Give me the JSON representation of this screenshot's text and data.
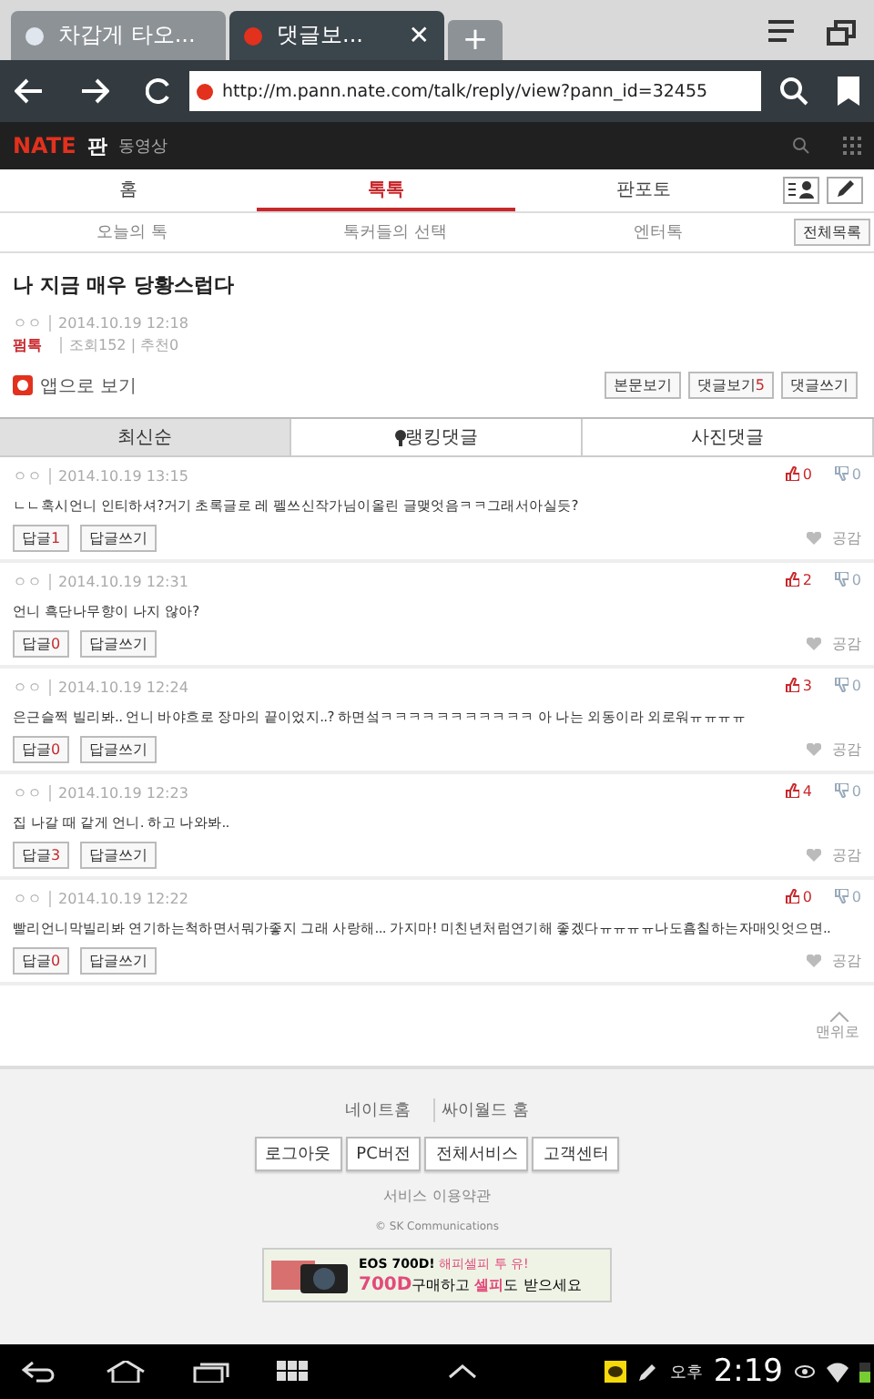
{
  "browser": {
    "tabs": [
      {
        "title": "차갑게 타오...",
        "selected": false
      },
      {
        "title": "댓글보...",
        "selected": true
      }
    ],
    "new_tab": "+",
    "close": "✕",
    "url": "http://m.pann.nate.com/talk/reply/view?pann_id=32455"
  },
  "site": {
    "logo": "NATE",
    "logo_sub": "판",
    "section": "동영상"
  },
  "nav": [
    {
      "label": "홈",
      "selected": false
    },
    {
      "label": "톡톡",
      "selected": true
    },
    {
      "label": "판포토",
      "selected": false
    }
  ],
  "subnav": [
    {
      "label": "오늘의 톡"
    },
    {
      "label": "톡커들의 선택"
    },
    {
      "label": "엔터톡"
    }
  ],
  "all_list": "전체목록",
  "post": {
    "title": "나 지금 매우 당황스럽다",
    "author": "ㅇㅇ",
    "date": "2014.10.19 12:18",
    "category": "펌톡",
    "stats": "조회152 | 추천0"
  },
  "app_link": "앱으로 보기",
  "post_buttons": [
    {
      "label": "본문보기"
    },
    {
      "label": "댓글보기",
      "count": "5"
    },
    {
      "label": "댓글쓰기"
    }
  ],
  "sort_tabs": [
    {
      "label": "최신순",
      "selected": true
    },
    {
      "label": "랭킹댓글",
      "selected": false
    },
    {
      "label": "사진댓글",
      "selected": false
    }
  ],
  "comments": [
    {
      "author": "ㅇㅇ",
      "date": "2014.10.19 13:15",
      "up": "0",
      "down": "0",
      "text": "ㄴㄴ혹시언니 인티하셔?거기 초록글로 레 펠쓰신작가님이올린 글맺엇음ㅋㅋ그래서아실듯?",
      "reply_label": "답글",
      "replies": "1",
      "write_reply": "답글쓰기",
      "like": "공감"
    },
    {
      "author": "ㅇㅇ",
      "date": "2014.10.19 12:31",
      "up": "2",
      "down": "0",
      "text": "언니 흑단나무향이 나지 않아?",
      "reply_label": "답글",
      "replies": "0",
      "write_reply": "답글쓰기",
      "like": "공감"
    },
    {
      "author": "ㅇㅇ",
      "date": "2014.10.19 12:24",
      "up": "3",
      "down": "0",
      "text": "은근슬쩍 빌리봐.. 언니 바야흐로 장마의 끝이었지..? 하면섴ㅋㅋㅋㅋㅋㅋㅋㅋㅋㅋㅋ 아 나는 외동이라 외로워ㅠㅠㅠㅠ",
      "reply_label": "답글",
      "replies": "0",
      "write_reply": "답글쓰기",
      "like": "공감"
    },
    {
      "author": "ㅇㅇ",
      "date": "2014.10.19 12:23",
      "up": "4",
      "down": "0",
      "text": "집 나갈 때 같게 언니. 하고 나와봐..",
      "reply_label": "답글",
      "replies": "3",
      "write_reply": "답글쓰기",
      "like": "공감"
    },
    {
      "author": "ㅇㅇ",
      "date": "2014.10.19 12:22",
      "up": "0",
      "down": "0",
      "text": "빨리언니막빌리봐 연기하는척하면서뭐가좋지 그래 사랑해... 가지마! 미친년처럼연기해 좋겠다ㅠㅠㅠㅠ나도흠칠하는자매잇엇으면..",
      "reply_label": "답글",
      "replies": "0",
      "write_reply": "답글쓰기",
      "like": "공감"
    }
  ],
  "to_top": "맨위로",
  "footer": {
    "links": [
      "네이트홈",
      "싸이월드 홈"
    ],
    "buttons": [
      "로그아웃",
      "PC버전",
      "전체서비스",
      "고객센터"
    ],
    "terms": "서비스 이용약관",
    "copyright": "© SK Communications"
  },
  "ad": {
    "line1": "EOS 700D!",
    "line1_accent": "해피셀피 투 유!",
    "line2_a": "700D",
    "line2_b": "구매하고",
    "line2_c": "셀피",
    "line2_d": "도 받으세요"
  },
  "status": {
    "ampm": "오후",
    "time": "2:19"
  }
}
